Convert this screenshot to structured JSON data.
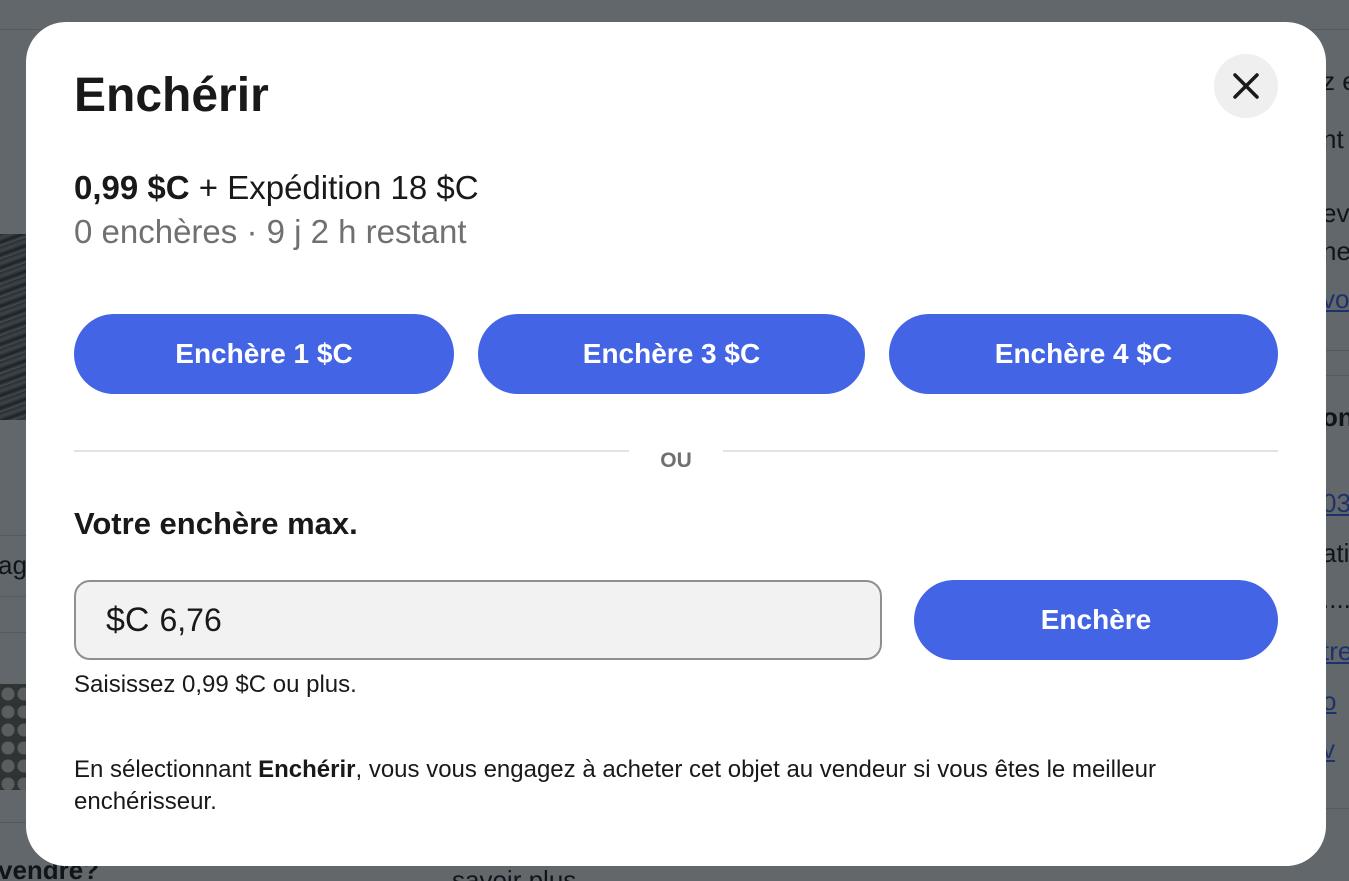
{
  "dialog": {
    "title": "Enchérir",
    "close_icon": "close-icon",
    "price": "0,99 $C",
    "shipping": "+ Expédition 18 $C",
    "status": "0 enchères · 9 j 2 h restant",
    "quick_bids": [
      {
        "label": "Enchère 1 $C"
      },
      {
        "label": "Enchère 3 $C"
      },
      {
        "label": "Enchère 4 $C"
      }
    ],
    "divider_text": "OU",
    "max_bid_label": "Votre enchère max.",
    "currency_prefix": "$C",
    "bid_value": "6,76",
    "submit_label": "Enchère",
    "hint": "Saisissez 0,99 $C ou plus.",
    "legal": {
      "prefix": "En sélectionnant ",
      "bold": "Enchérir",
      "suffix": ", vous vous engagez à acheter cet objet au vendeur si vous êtes le meilleur enchérisseur."
    }
  },
  "colors": {
    "accent": "#4264e5",
    "overlay": "#5e646c",
    "text": "#191919",
    "muted": "#707070"
  }
}
